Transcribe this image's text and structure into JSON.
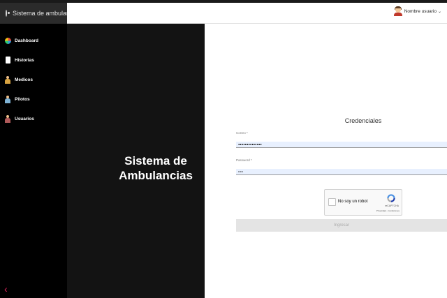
{
  "app": {
    "title": "Sistema de ambulancia"
  },
  "sidebar": {
    "items": [
      {
        "label": "Dashboard"
      },
      {
        "label": "Historias"
      },
      {
        "label": "Medicos"
      },
      {
        "label": "Pilotos"
      },
      {
        "label": "Usuarios"
      }
    ],
    "collapse_glyph": "‹"
  },
  "header": {
    "user_name": "Nombre usuario",
    "chevron": "⌄"
  },
  "hero": {
    "line1": "Sistema de",
    "line2": "Ambulancias"
  },
  "form": {
    "title": "Credenciales",
    "email_label": "Correo *",
    "email_value": "●●●●●●●●●●●●●●",
    "password_label": "Password *",
    "password_value": "•••••",
    "submit_label": "Ingresar"
  },
  "captcha": {
    "label": "No soy un robot",
    "brand": "reCAPTCHA",
    "links": "Privacidad - Condiciones"
  },
  "colors": {
    "sidebar_bg": "#000000",
    "brand_bg": "#2b2b2b",
    "hero_bg": "#131313",
    "input_bg": "#e8f0fe",
    "collapse_accent": "#e0245e"
  }
}
